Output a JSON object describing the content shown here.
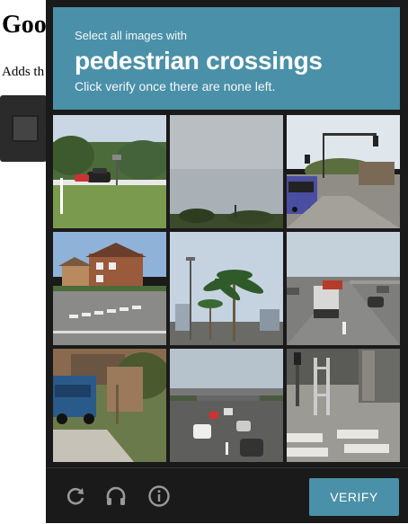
{
  "page": {
    "title": "Goo",
    "subtitle": "Adds th"
  },
  "challenge": {
    "prompt_small": "Select all images with",
    "target": "pedestrian crossings",
    "instruction": "Click verify once there are none left."
  },
  "tiles": [
    {
      "row": 1,
      "col": 1,
      "scene": "road with white car and trees"
    },
    {
      "row": 1,
      "col": 2,
      "scene": "grey sky over trees"
    },
    {
      "row": 1,
      "col": 3,
      "scene": "bus at traffic light intersection"
    },
    {
      "row": 2,
      "col": 1,
      "scene": "brick houses at intersection with crosswalk"
    },
    {
      "row": 2,
      "col": 2,
      "scene": "palm trees and street light"
    },
    {
      "row": 2,
      "col": 3,
      "scene": "highway with trucks"
    },
    {
      "row": 3,
      "col": 1,
      "scene": "blue pickup truck in driveway"
    },
    {
      "row": 3,
      "col": 2,
      "scene": "highway traffic under overpass"
    },
    {
      "row": 3,
      "col": 3,
      "scene": "crosswalk with hand truck"
    }
  ],
  "footer": {
    "reload_icon": "reload-icon",
    "audio_icon": "headphones-icon",
    "info_icon": "info-icon",
    "verify_label": "VERIFY"
  },
  "colors": {
    "accent": "#4a90a8",
    "panel": "#1a1a1a"
  }
}
